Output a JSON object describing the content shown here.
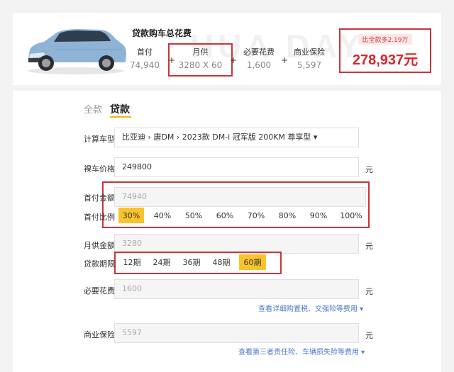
{
  "summary": {
    "title": "贷款购车总花费",
    "watermark": "HUA DAY",
    "cols": [
      {
        "label": "首付",
        "value": "74,940"
      },
      {
        "label": "月供",
        "value": "3280 X 60"
      },
      {
        "label": "必要花费",
        "value": "1,600"
      },
      {
        "label": "商业保险",
        "value": "5,597"
      }
    ],
    "ops": [
      "+",
      "+",
      "+"
    ],
    "total_badge": "比全款多2.19万",
    "total_value": "278,937元"
  },
  "tabs": {
    "full": "全款",
    "loan": "贷款"
  },
  "form": {
    "car_model": {
      "label": "计算车型",
      "value": "比亚迪 › 唐DM › 2023款 DM-i 冠军版 200KM 尊享型 ▾"
    },
    "car_price": {
      "label": "裸车价格",
      "value": "249800",
      "unit": "元"
    },
    "down_payment": {
      "label": "首付金额",
      "value": "74940"
    },
    "down_ratio": {
      "label": "首付比例",
      "options": [
        "30%",
        "40%",
        "50%",
        "60%",
        "70%",
        "80%",
        "90%",
        "100%"
      ],
      "selected": "30%"
    },
    "monthly": {
      "label": "月供金额",
      "value": "3280",
      "unit": "元"
    },
    "term": {
      "label": "贷款期限",
      "options": [
        "12期",
        "24期",
        "36期",
        "48期",
        "60期"
      ],
      "selected": "60期"
    },
    "required": {
      "label": "必要花费",
      "value": "1600",
      "unit": "元",
      "link": "查看详细购置税、交强险等费用 ▾"
    },
    "insurance": {
      "label": "商业保险",
      "value": "5597",
      "unit": "元",
      "link": "查看第三者责任险、车辆损失险等费用 ▾"
    }
  },
  "colors": {
    "accent": "#f8c32c",
    "highlight_border": "#c9353a",
    "total": "#d8262c",
    "link": "#4b79c9"
  }
}
